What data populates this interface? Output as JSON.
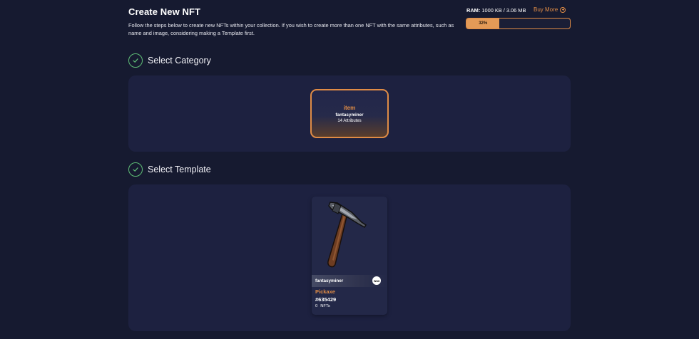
{
  "header": {
    "title": "Create New NFT",
    "description": "Follow the steps below to create new NFTs within your collection. If you wish to create more than one NFT with the same attributes, such as name and image, considering making a Template first."
  },
  "ram": {
    "label": "RAM:",
    "value": "1000 KB / 3.06 MB",
    "buy_label": "Buy More",
    "usage_percent": 32,
    "usage_text": "32%"
  },
  "steps": {
    "category": {
      "label": "Select Category",
      "card": {
        "title": "item",
        "collection": "fantasyminer",
        "attributes": "14 Attributes"
      }
    },
    "template": {
      "label": "Select Template",
      "card": {
        "collection": "fantasyminer",
        "name": "Pickaxe",
        "id": "#635429",
        "count": "0",
        "count_label": "NFTs"
      }
    }
  },
  "colors": {
    "accent": "#e08c46",
    "success": "#5fbf77",
    "background": "#161a30",
    "panel": "#1d2140"
  },
  "icons": {
    "step_complete": "check-circle-icon",
    "buy_more": "plus-circle-icon",
    "template_image": "pickaxe-image",
    "collection_logo": "wax-logo-icon"
  }
}
